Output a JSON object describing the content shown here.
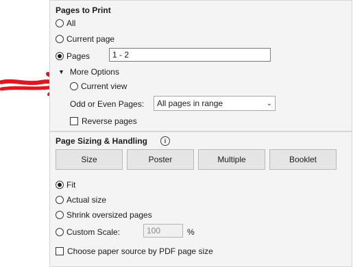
{
  "pages_to_print": {
    "heading": "Pages to Print",
    "options": {
      "all": "All",
      "current_page": "Current page",
      "pages": "Pages"
    },
    "pages_value": "1 - 2",
    "more_options": {
      "label": "More Options",
      "current_view": "Current view",
      "odd_even_label": "Odd or Even Pages:",
      "odd_even_value": "All pages in range",
      "reverse_pages": "Reverse pages"
    }
  },
  "sizing": {
    "heading": "Page Sizing & Handling",
    "info_glyph": "i",
    "buttons": {
      "size": "Size",
      "poster": "Poster",
      "multiple": "Multiple",
      "booklet": "Booklet"
    },
    "options": {
      "fit": "Fit",
      "actual_size": "Actual size",
      "shrink": "Shrink oversized pages",
      "custom_scale": "Custom Scale:"
    },
    "scale_value": "100",
    "scale_unit": "%",
    "paper_source": "Choose paper source by PDF page size"
  },
  "annotation": {
    "arrow_color": "#e8141b"
  }
}
